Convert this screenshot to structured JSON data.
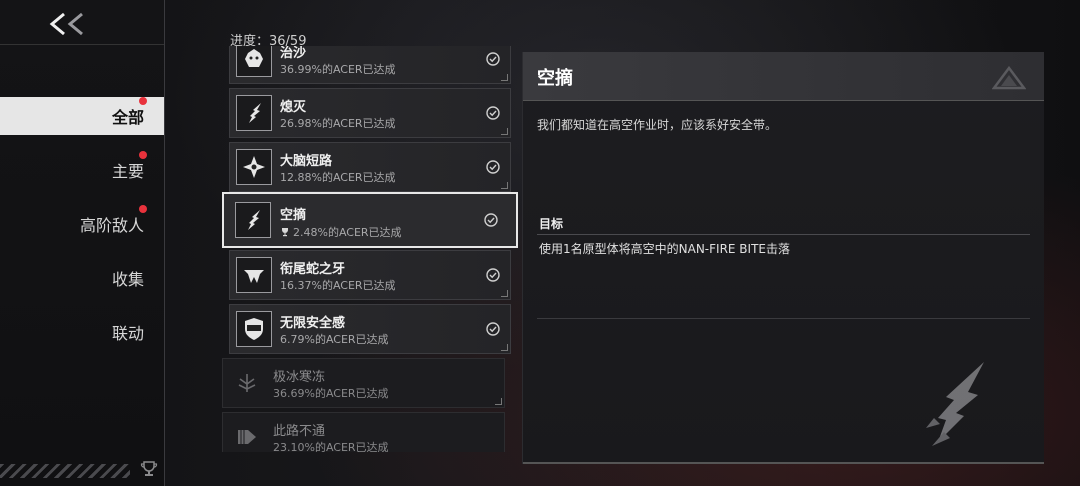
{
  "nav": {
    "back_icon": "double-chevron-left-icon",
    "items": [
      {
        "label": "全部",
        "active": true,
        "dot": true
      },
      {
        "label": "主要",
        "active": false,
        "dot": true
      },
      {
        "label": "高阶敌人",
        "active": false,
        "dot": true
      },
      {
        "label": "收集",
        "active": false,
        "dot": false
      },
      {
        "label": "联动",
        "active": false,
        "dot": false
      }
    ],
    "footer_icon": "trophy-icon"
  },
  "progress": "进度：36/59",
  "achievements": [
    {
      "name": "治沙",
      "rate": "36.99%的ACER已达成",
      "icon": "beast-head-icon",
      "status": "done"
    },
    {
      "name": "熄灭",
      "rate": "26.98%的ACER已达成",
      "icon": "dragon-claw-icon",
      "status": "done"
    },
    {
      "name": "大脑短路",
      "rate": "12.88%的ACER已达成",
      "icon": "shuriken-icon",
      "status": "done"
    },
    {
      "name": "空摘",
      "rate": "2.48%的ACER已达成",
      "icon": "dragon-claw-icon",
      "status": "selected"
    },
    {
      "name": "衔尾蛇之牙",
      "rate": "16.37%的ACER已达成",
      "icon": "fang-icon",
      "status": "done"
    },
    {
      "name": "无限安全感",
      "rate": "6.79%的ACER已达成",
      "icon": "shield-1000-icon",
      "status": "done"
    },
    {
      "name": "极冰寒冻",
      "rate": "36.69%的ACER已达成",
      "icon": "ice-crystal-icon",
      "status": "locked"
    },
    {
      "name": "此路不通",
      "rate": "23.10%的ACER已达成",
      "icon": "drill-icon",
      "status": "locked"
    }
  ],
  "detail": {
    "title": "空摘",
    "description": "我们都知道在高空作业时，应该系好安全带。",
    "goal_label": "目标",
    "goal_text": "使用1名原型体将高空中的NAN-FIRE BITE击落",
    "logo_icon": "triangle-logo-icon",
    "art_icon": "dragon-claw-icon"
  }
}
